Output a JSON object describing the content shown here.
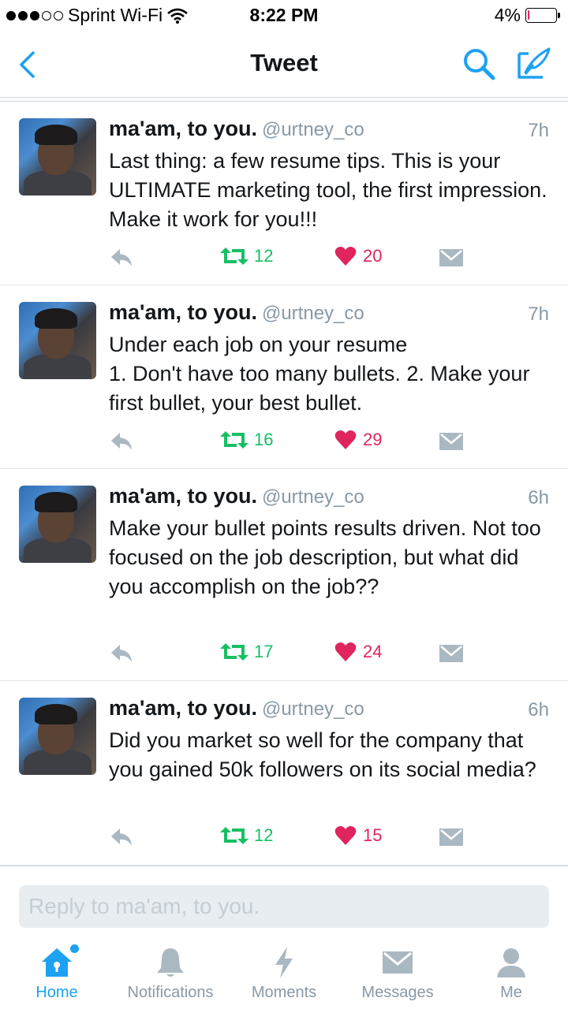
{
  "status_bar": {
    "carrier": "Sprint Wi-Fi",
    "time": "8:22 PM",
    "battery_percent": "4%",
    "battery_level": 0.04,
    "signal_bars_filled": 3,
    "signal_bars_total": 5
  },
  "nav": {
    "title": "Tweet"
  },
  "colors": {
    "accent": "#1da1f2",
    "retweet": "#17bf63",
    "like": "#e0245e",
    "muted": "#8899a6"
  },
  "tweets": [
    {
      "name": "ma'am, to you.",
      "handle": "@urtney_co",
      "time": "7h",
      "text": "Last thing: a few resume tips. This is your ULTIMATE marketing tool, the first impression. Make it work for you!!!",
      "retweets": "12",
      "likes": "20"
    },
    {
      "name": "ma'am, to you.",
      "handle": "@urtney_co",
      "time": "7h",
      "text": "Under each job on your resume\n1. Don't have too many bullets. 2. Make your first bullet, your best bullet.",
      "retweets": "16",
      "likes": "29"
    },
    {
      "name": "ma'am, to you.",
      "handle": "@urtney_co",
      "time": "6h",
      "text": "Make your bullet points results driven. Not too focused on the job description, but what did you accomplish on the job??",
      "retweets": "17",
      "likes": "24"
    },
    {
      "name": "ma'am, to you.",
      "handle": "@urtney_co",
      "time": "6h",
      "text": "Did you market so well for the company that you gained 50k followers on its social media?",
      "retweets": "12",
      "likes": "15"
    }
  ],
  "reply": {
    "placeholder": "Reply to ma'am, to you."
  },
  "tabs": [
    {
      "label": "Home",
      "icon": "home-icon",
      "active": true
    },
    {
      "label": "Notifications",
      "icon": "bell-icon",
      "active": false
    },
    {
      "label": "Moments",
      "icon": "lightning-icon",
      "active": false
    },
    {
      "label": "Messages",
      "icon": "envelope-icon",
      "active": false
    },
    {
      "label": "Me",
      "icon": "person-icon",
      "active": false
    }
  ]
}
